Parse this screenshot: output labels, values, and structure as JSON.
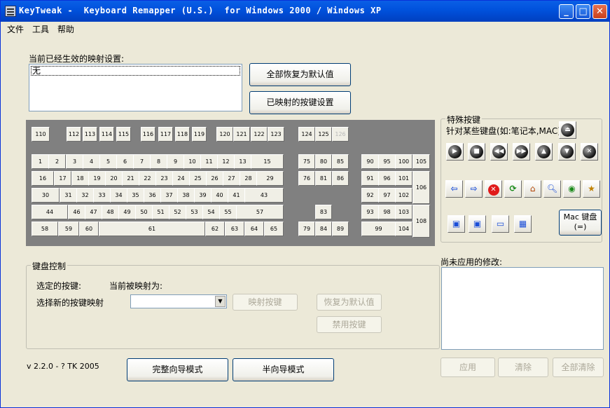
{
  "window": {
    "title": "KeyTweak -  Keyboard Remapper (U.S.)  for Windows 2000 / Windows XP"
  },
  "menu": [
    "文件",
    "工具",
    "帮助"
  ],
  "current_mappings": {
    "label": "当前已经生效的映射设置:",
    "items": [
      "无"
    ]
  },
  "buttons": {
    "restore_all": "全部恢复为默认值",
    "mapped_keys": "已映射的按键设置",
    "map_key": "映射按键",
    "restore_default": "恢复为默认值",
    "disable_key": "禁用按键",
    "full_wizard": "完整向导模式",
    "half_wizard": "半向导模式",
    "apply": "应用",
    "clear": "清除",
    "clear_all": "全部清除",
    "mac_keyboard": "Mac 键盘\n(=)"
  },
  "special_keys": {
    "title": "特殊按键",
    "subtitle": "针对某些键盘(如:笔记本,MAC)"
  },
  "keyboard_control": {
    "title": "键盘控制",
    "selected_key": "选定的按键:",
    "current_mapped": "当前被映射为:",
    "choose_new": "选择新的按键映射"
  },
  "pending": {
    "label": "尚未应用的修改:"
  },
  "version": "v 2.2.0 - ? TK 2005",
  "keys": {
    "fn_row": [
      "110",
      "112",
      "113",
      "114",
      "115",
      "116",
      "117",
      "118",
      "119",
      "120",
      "121",
      "122",
      "123",
      "124",
      "125",
      "126"
    ],
    "row1": [
      "1",
      "2",
      "3",
      "4",
      "5",
      "6",
      "7",
      "8",
      "9",
      "10",
      "11",
      "12",
      "13",
      "15"
    ],
    "row2": [
      "16",
      "17",
      "18",
      "19",
      "20",
      "21",
      "22",
      "23",
      "24",
      "25",
      "26",
      "27",
      "28",
      "29"
    ],
    "row3": [
      "30",
      "31",
      "32",
      "33",
      "34",
      "35",
      "36",
      "37",
      "38",
      "39",
      "40",
      "41",
      "43"
    ],
    "row4": [
      "44",
      "46",
      "47",
      "48",
      "49",
      "50",
      "51",
      "52",
      "53",
      "54",
      "55",
      "57"
    ],
    "row5": [
      "58",
      "59",
      "60",
      "61",
      "62",
      "63",
      "64",
      "65"
    ],
    "nav": [
      "75",
      "80",
      "85",
      "76",
      "81",
      "86",
      "83",
      "79",
      "84",
      "89"
    ],
    "numpad": [
      "90",
      "95",
      "100",
      "105",
      "91",
      "96",
      "101",
      "106",
      "92",
      "97",
      "102",
      "93",
      "98",
      "103",
      "108",
      "99",
      "104"
    ]
  }
}
